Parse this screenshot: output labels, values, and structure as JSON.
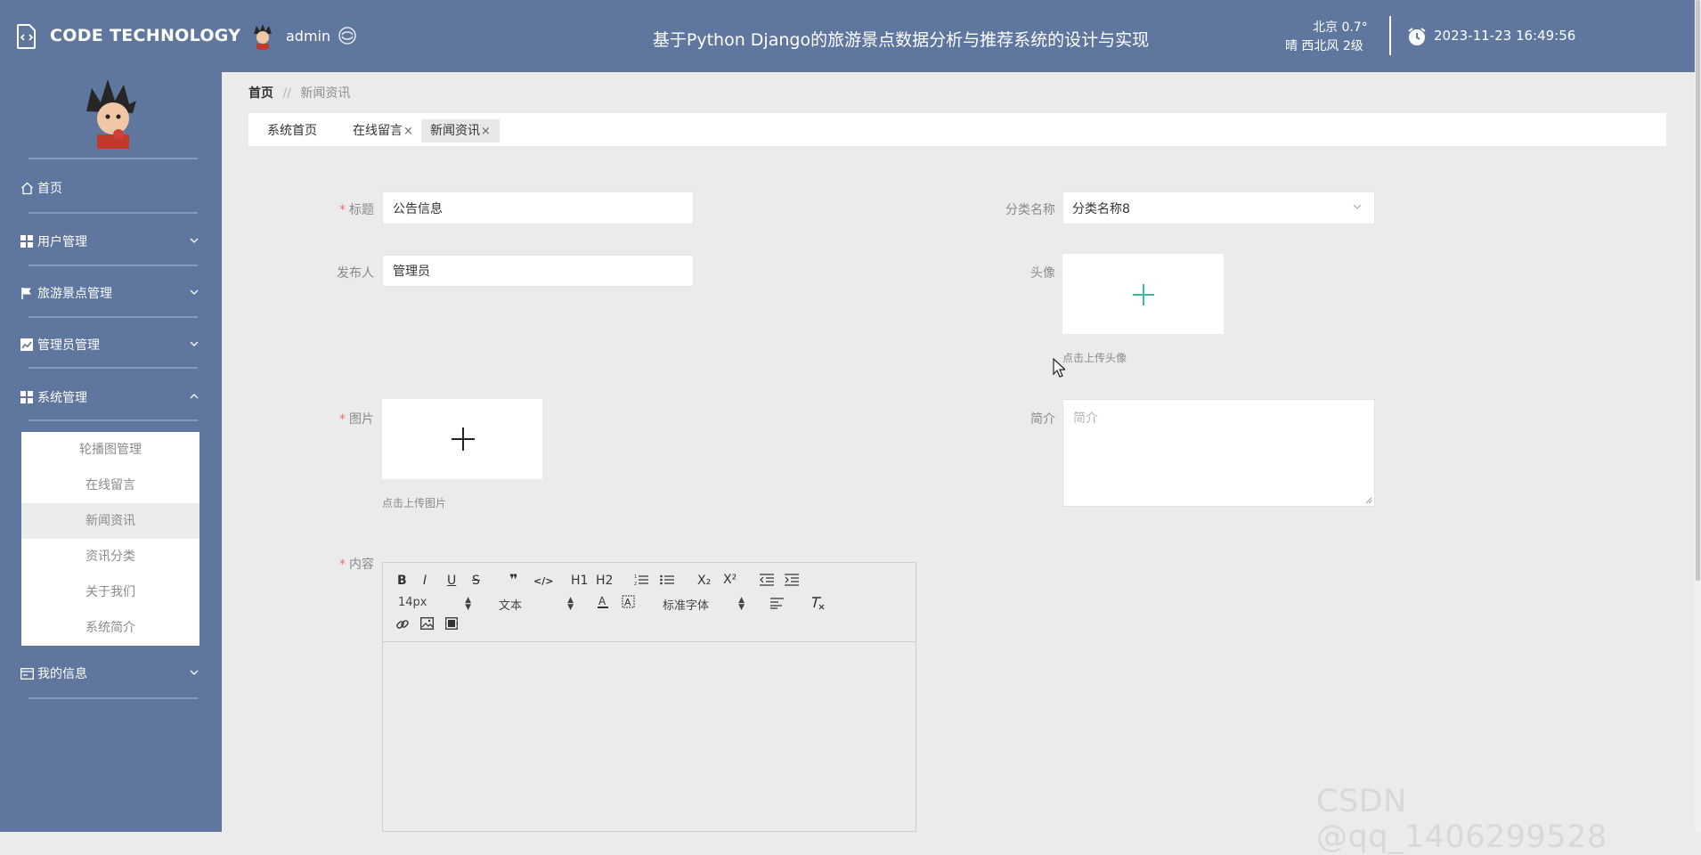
{
  "header": {
    "logo_text": "CODE TECHNOLOGY",
    "user_name": "admin",
    "system_title": "基于Python Django的旅游景点数据分析与推荐系统的设计与实现",
    "weather_city_temp": "北京  0.7°",
    "weather_desc": "晴  西北风  2级",
    "datetime": "2023-11-23 16:49:56"
  },
  "sidebar": {
    "items": [
      {
        "label": "首页",
        "icon": "home-icon"
      },
      {
        "label": "用户管理",
        "icon": "grid-icon"
      },
      {
        "label": "旅游景点管理",
        "icon": "flag-icon"
      },
      {
        "label": "管理员管理",
        "icon": "chart-icon"
      },
      {
        "label": "系统管理",
        "icon": "grid-icon"
      },
      {
        "label": "我的信息",
        "icon": "card-icon"
      }
    ],
    "submenu": [
      "轮播图管理",
      "在线留言",
      "新闻资讯",
      "资讯分类",
      "关于我们",
      "系统简介"
    ]
  },
  "breadcrumb": {
    "home": "首页",
    "separator": "//",
    "current": "新闻资讯"
  },
  "tabs": [
    {
      "label": "系统首页",
      "closable": false
    },
    {
      "label": "在线留言",
      "closable": true
    },
    {
      "label": "新闻资讯",
      "closable": true
    }
  ],
  "tab_close": "×",
  "form": {
    "title_label": "标题",
    "title_value": "公告信息",
    "category_label": "分类名称",
    "category_value": "分类名称8",
    "publisher_label": "发布人",
    "publisher_value": "管理员",
    "avatar_label": "头像",
    "avatar_hint": "点击上传头像",
    "image_label": "图片",
    "image_hint": "点击上传图片",
    "intro_label": "简介",
    "intro_placeholder": "简介",
    "content_label": "内容",
    "required_mark": "*"
  },
  "editor": {
    "buttons_row1": [
      "B",
      "I",
      "U",
      "S",
      "❞",
      "</>",
      "H1",
      "H2",
      "ordered-list",
      "bullet-list",
      "X₂",
      "X²",
      "outdent",
      "indent"
    ],
    "font_size": "14px",
    "header_select": "文本",
    "font_family": "标准字体"
  },
  "watermark": "CSDN @qq_1406299528",
  "colors": {
    "header_bg": "#5f779f",
    "sidebar_bg": "#5f779f",
    "page_bg": "#ebebeb",
    "required": "#f56c6c",
    "accent": "#3cb9a0"
  }
}
